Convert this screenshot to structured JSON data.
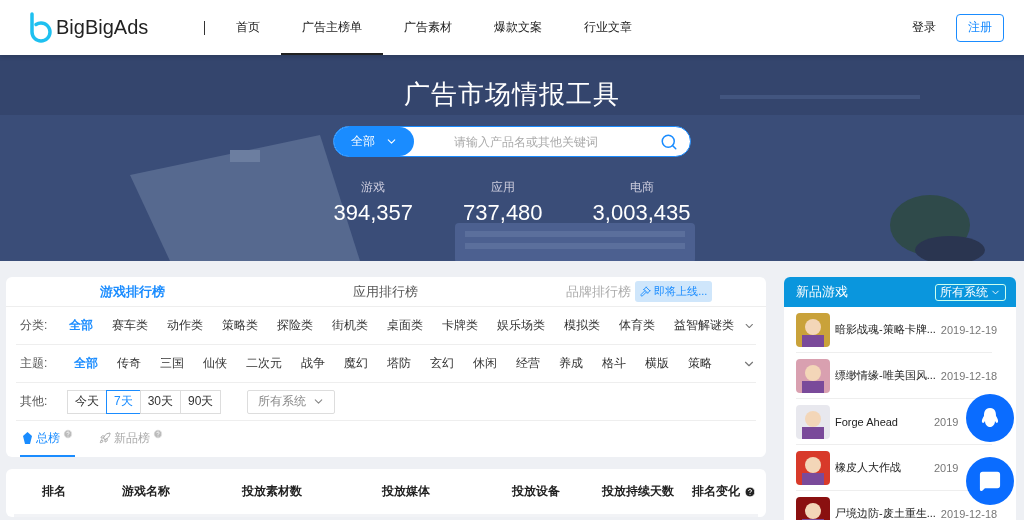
{
  "header": {
    "logo": "BigBigAds",
    "nav": [
      {
        "label": "首页",
        "selected": false
      },
      {
        "label": "广告主榜单",
        "selected": true
      },
      {
        "label": "广告素材",
        "selected": false
      },
      {
        "label": "爆款文案",
        "selected": false
      },
      {
        "label": "行业文章",
        "selected": false
      }
    ],
    "login": "登录",
    "register": "注册"
  },
  "hero": {
    "title": "广告市场情报工具",
    "search": {
      "scope": "全部",
      "placeholder": "请输入产品名或其他关键词"
    },
    "stats": [
      {
        "label": "游戏",
        "value": "394,357"
      },
      {
        "label": "应用",
        "value": "737,480"
      },
      {
        "label": "电商",
        "value": "3,003,435"
      }
    ]
  },
  "rank_tabs": [
    {
      "label": "游戏排行榜",
      "selected": true,
      "disabled": false
    },
    {
      "label": "应用排行榜",
      "selected": false,
      "disabled": false
    },
    {
      "label": "品牌排行榜",
      "selected": false,
      "disabled": true,
      "badge": "即将上线..."
    }
  ],
  "filters": [
    {
      "label": "分类:",
      "options": [
        {
          "label": "全部",
          "selected": true
        },
        {
          "label": "赛车类",
          "selected": false
        },
        {
          "label": "动作类",
          "selected": false
        },
        {
          "label": "策略类",
          "selected": false
        },
        {
          "label": "探险类",
          "selected": false
        },
        {
          "label": "街机类",
          "selected": false
        },
        {
          "label": "桌面类",
          "selected": false
        },
        {
          "label": "卡牌类",
          "selected": false
        },
        {
          "label": "娱乐场类",
          "selected": false
        },
        {
          "label": "模拟类",
          "selected": false
        },
        {
          "label": "体育类",
          "selected": false
        },
        {
          "label": "益智解谜类",
          "selected": false
        }
      ]
    },
    {
      "label": "主题:",
      "options": [
        {
          "label": "全部",
          "selected": true
        },
        {
          "label": "传奇",
          "selected": false
        },
        {
          "label": "三国",
          "selected": false
        },
        {
          "label": "仙侠",
          "selected": false
        },
        {
          "label": "二次元",
          "selected": false
        },
        {
          "label": "战争",
          "selected": false
        },
        {
          "label": "魔幻",
          "selected": false
        },
        {
          "label": "塔防",
          "selected": false
        },
        {
          "label": "玄幻",
          "selected": false
        },
        {
          "label": "休闲",
          "selected": false
        },
        {
          "label": "经营",
          "selected": false
        },
        {
          "label": "养成",
          "selected": false
        },
        {
          "label": "格斗",
          "selected": false
        },
        {
          "label": "横版",
          "selected": false
        },
        {
          "label": "策略",
          "selected": false
        }
      ]
    }
  ],
  "other": {
    "label": "其他:",
    "periods": [
      {
        "label": "今天",
        "selected": false
      },
      {
        "label": "7天",
        "selected": true
      },
      {
        "label": "30天",
        "selected": false
      },
      {
        "label": "90天",
        "selected": false
      }
    ],
    "system": "所有系统"
  },
  "list_tabs": [
    {
      "label": "总榜",
      "selected": true
    },
    {
      "label": "新品榜",
      "selected": false
    }
  ],
  "table": {
    "columns": [
      "排名",
      "游戏名称",
      "投放素材数",
      "投放媒体",
      "投放设备",
      "投放持续天数",
      "排名变化"
    ]
  },
  "new_games": {
    "title": "新品游戏",
    "system": "所有系统",
    "items": [
      {
        "name": "暗影战魂-策略卡牌...",
        "date": "2019-12-19"
      },
      {
        "name": "缥缈情缘-唯美国风...",
        "date": "2019-12-18"
      },
      {
        "name": "Forge Ahead",
        "date": "2019"
      },
      {
        "name": "橡皮人大作战",
        "date": "2019"
      },
      {
        "name": "尸境边防-废土重生...",
        "date": "2019-12-18"
      }
    ]
  }
}
